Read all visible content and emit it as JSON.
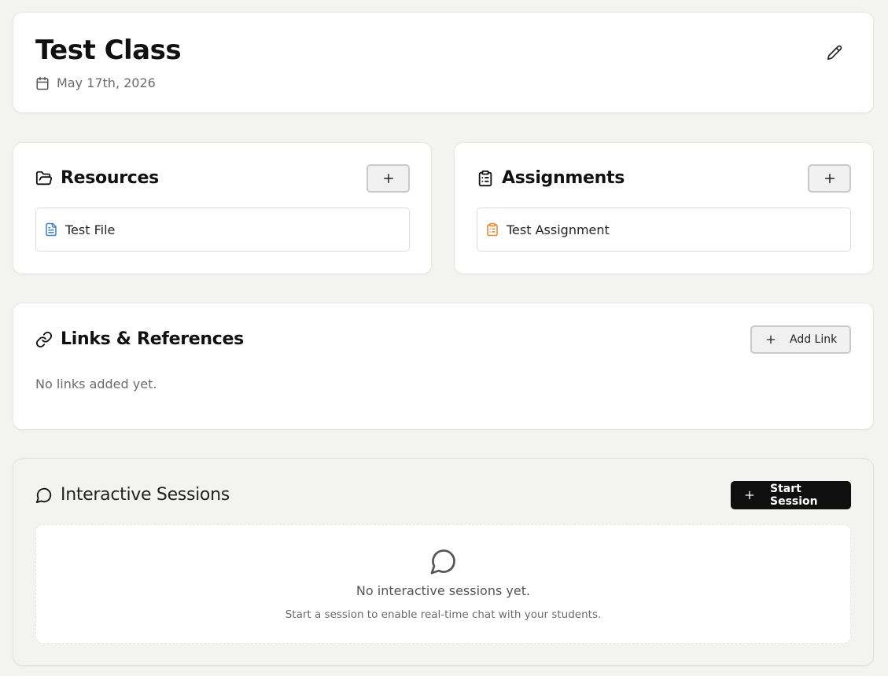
{
  "header": {
    "title": "Test Class",
    "date": "May 17th, 2026",
    "icons": {
      "date": "calendar-icon",
      "edit": "pencil-icon"
    }
  },
  "resources": {
    "title": "Resources",
    "add_label": "+",
    "items": [
      {
        "label": "Test File",
        "icon": "file-text-icon",
        "icon_color": "#3b82c4"
      }
    ]
  },
  "assignments": {
    "title": "Assignments",
    "add_label": "+",
    "items": [
      {
        "label": "Test Assignment",
        "icon": "clipboard-list-icon",
        "icon_color": "#e8862a"
      }
    ]
  },
  "links": {
    "title": "Links & References",
    "add_button_label": "Add Link",
    "empty_text": "No links added yet."
  },
  "sessions": {
    "title": "Interactive Sessions",
    "start_button_label": "Start Session",
    "empty_title": "No interactive sessions yet.",
    "empty_subtitle": "Start a session to enable real-time chat with your students."
  },
  "colors": {
    "background": "#f3f3f1",
    "card": "#ffffff",
    "primary_button": "#0f0f0f",
    "file_icon": "#3b82c4",
    "assignment_icon": "#e8862a"
  }
}
